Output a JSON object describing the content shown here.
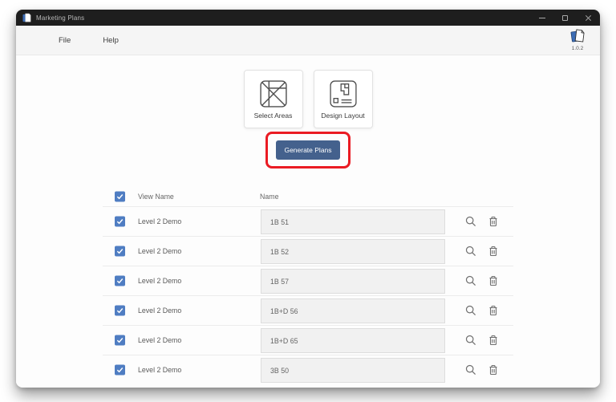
{
  "window": {
    "title": "Marketing Plans",
    "controls": [
      {
        "name": "minimize"
      },
      {
        "name": "maximize"
      },
      {
        "name": "close"
      }
    ]
  },
  "menubar": {
    "items": [
      {
        "label": "File"
      },
      {
        "label": "Help"
      }
    ],
    "brand_icon": "app-logo-pages-icon",
    "version": "1.0.2"
  },
  "actions": {
    "cards": [
      {
        "label": "Select Areas",
        "icon": "select-areas-icon"
      },
      {
        "label": "Design Layout",
        "icon": "design-layout-icon"
      }
    ],
    "generate_button_label": "Generate Plans",
    "annotation": {
      "shape": "red-rectangle-highlight",
      "color": "#ea1b23"
    }
  },
  "table": {
    "headers": {
      "view_name": "View Name",
      "name": "Name"
    },
    "select_all_checked": true,
    "row_icons": [
      "search-icon",
      "delete-icon"
    ],
    "rows": [
      {
        "checked": true,
        "view_name": "Level 2 Demo",
        "name": "1B 51"
      },
      {
        "checked": true,
        "view_name": "Level 2 Demo",
        "name": "1B 52"
      },
      {
        "checked": true,
        "view_name": "Level 2 Demo",
        "name": "1B 57"
      },
      {
        "checked": true,
        "view_name": "Level 2 Demo",
        "name": "1B+D 56"
      },
      {
        "checked": true,
        "view_name": "Level 2 Demo",
        "name": "1B+D 65"
      },
      {
        "checked": true,
        "view_name": "Level 2 Demo",
        "name": "3B 50"
      }
    ]
  },
  "colors": {
    "titlebar": "#1e1e1e",
    "button_blue": "#44618d",
    "checkbox_blue": "#4f7dc2",
    "annotation_red": "#ea1b23",
    "field_gray": "#f1f1f1"
  }
}
